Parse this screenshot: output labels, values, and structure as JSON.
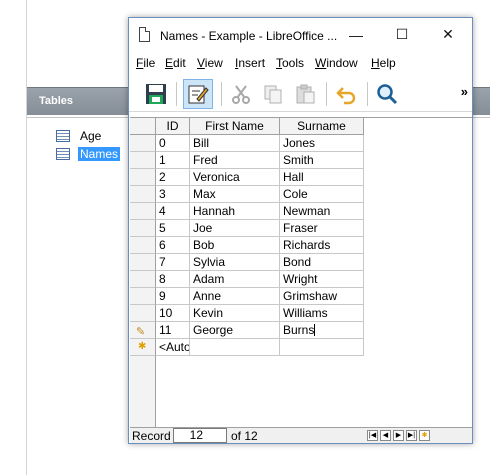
{
  "background": {
    "panel_header": "Tables",
    "tables": [
      {
        "label": "Age",
        "selected": false
      },
      {
        "label": "Names",
        "selected": true
      }
    ]
  },
  "window": {
    "title": "Names - Example - LibreOffice ...",
    "controls": {
      "minimize": "—",
      "maximize": "☐",
      "close": "✕"
    }
  },
  "menu": [
    {
      "label": "File",
      "accel": "F",
      "rest": "ile"
    },
    {
      "label": "Edit",
      "accel": "E",
      "rest": "dit"
    },
    {
      "label": "View",
      "accel": "V",
      "rest": "iew"
    },
    {
      "label": "Insert",
      "accel": "I",
      "rest": "nsert"
    },
    {
      "label": "Tools",
      "accel": "T",
      "rest": "ools"
    },
    {
      "label": "Window",
      "accel": "W",
      "rest": "indow"
    },
    {
      "label": "Help",
      "accel": "H",
      "rest": "elp"
    }
  ],
  "toolbar": {
    "items": [
      "save-icon",
      "edit-data-icon",
      "cut-icon",
      "copy-icon",
      "paste-icon",
      "undo-icon",
      "find-icon"
    ],
    "more": "»"
  },
  "grid": {
    "columns": [
      "ID",
      "First Name",
      "Surname"
    ],
    "rows": [
      [
        "0",
        "Bill",
        "Jones"
      ],
      [
        "1",
        "Fred",
        "Smith"
      ],
      [
        "2",
        "Veronica",
        "Hall"
      ],
      [
        "3",
        "Max",
        "Cole"
      ],
      [
        "4",
        "Hannah",
        "Newman"
      ],
      [
        "5",
        "Joe",
        "Fraser"
      ],
      [
        "6",
        "Bob",
        "Richards"
      ],
      [
        "7",
        "Sylvia",
        "Bond"
      ],
      [
        "8",
        "Adam",
        "Wright"
      ],
      [
        "9",
        "Anne",
        "Grimshaw"
      ],
      [
        "10",
        "Kevin",
        "Williams"
      ],
      [
        "11",
        "George",
        "Burns"
      ]
    ],
    "new_row_placeholder": "<AutoValue>",
    "editing_row": 11
  },
  "navigation": {
    "label": "Record",
    "current": "12",
    "of_label": "of 12"
  },
  "colors": {
    "selection": "#3399ff",
    "active_tool": "#cde6f7",
    "window_border": "#6a8fbf"
  }
}
